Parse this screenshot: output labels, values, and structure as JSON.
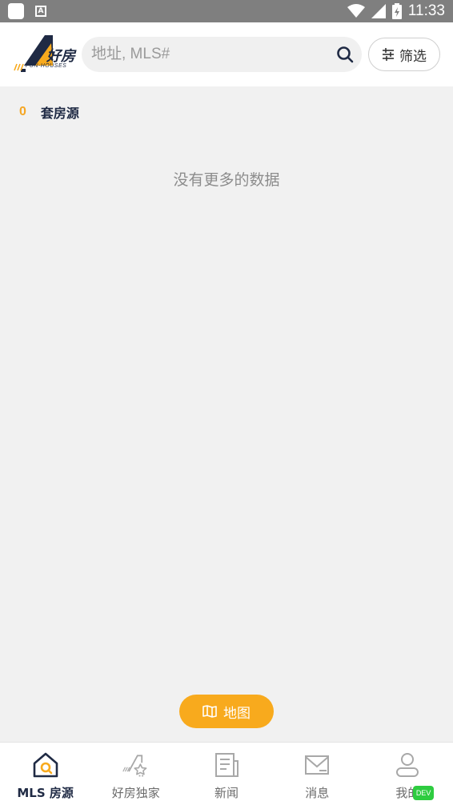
{
  "status_bar": {
    "time": "11:33",
    "left_icons": [
      "app-square-icon",
      "keyboard-a-icon"
    ],
    "right_icons": [
      "wifi-icon",
      "cellular-icon",
      "battery-icon"
    ]
  },
  "header": {
    "logo_text": "好房",
    "logo_subtext": "FUN-HOUSES",
    "search_placeholder": "地址, MLS#",
    "search_value": "",
    "filter_label": "筛选"
  },
  "results": {
    "count": "0",
    "count_label": "套房源",
    "empty_message": "没有更多的数据"
  },
  "map_button": {
    "label": "地图"
  },
  "bottom_nav": {
    "items": [
      {
        "label": "MLS 房源",
        "icon": "house-search-icon",
        "active": true
      },
      {
        "label": "好房独家",
        "icon": "exclusive-house-icon",
        "active": false
      },
      {
        "label": "新闻",
        "icon": "newspaper-icon",
        "active": false
      },
      {
        "label": "消息",
        "icon": "mail-icon",
        "active": false
      },
      {
        "label": "我的",
        "icon": "user-icon",
        "active": false
      }
    ],
    "badge": "DEV"
  },
  "colors": {
    "accent": "#f8aa1d",
    "navy": "#1f2a44",
    "background": "#f1f1f1",
    "status_bar": "#7f7f7f"
  }
}
